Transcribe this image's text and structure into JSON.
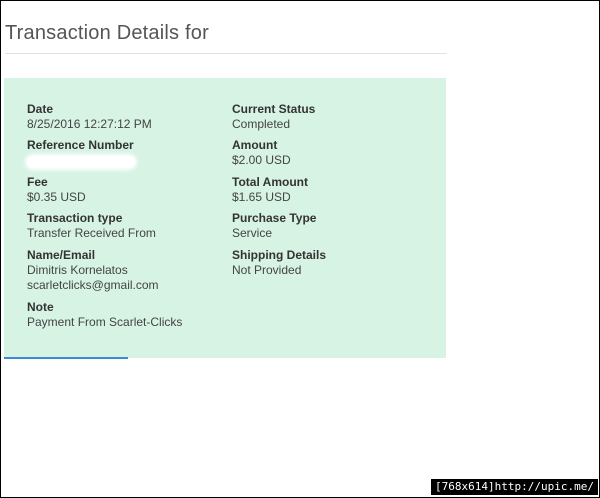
{
  "page": {
    "title": "Transaction Details for"
  },
  "details": {
    "date": {
      "label": "Date",
      "value": "8/25/2016 12:27:12 PM"
    },
    "current_status": {
      "label": "Current Status",
      "value": "Completed"
    },
    "reference_number": {
      "label": "Reference Number",
      "value": ""
    },
    "amount": {
      "label": "Amount",
      "value": "$2.00 USD"
    },
    "fee": {
      "label": "Fee",
      "value": "$0.35 USD"
    },
    "total_amount": {
      "label": "Total Amount",
      "value": "$1.65 USD"
    },
    "transaction_type": {
      "label": "Transaction type",
      "value": "Transfer Received From"
    },
    "purchase_type": {
      "label": "Purchase Type",
      "value": "Service"
    },
    "name_email": {
      "label": "Name/Email",
      "name": "Dimitris Kornelatos",
      "email": "scarletclicks@gmail.com"
    },
    "shipping_details": {
      "label": "Shipping Details",
      "value": "Not Provided"
    },
    "note": {
      "label": "Note",
      "value": "Payment From Scarlet-Clicks"
    }
  },
  "watermark": {
    "text": "[768x614]http://upic.me/"
  },
  "colors": {
    "panel_background": "#d6f3e4",
    "link_accent": "#3c8ad6"
  }
}
